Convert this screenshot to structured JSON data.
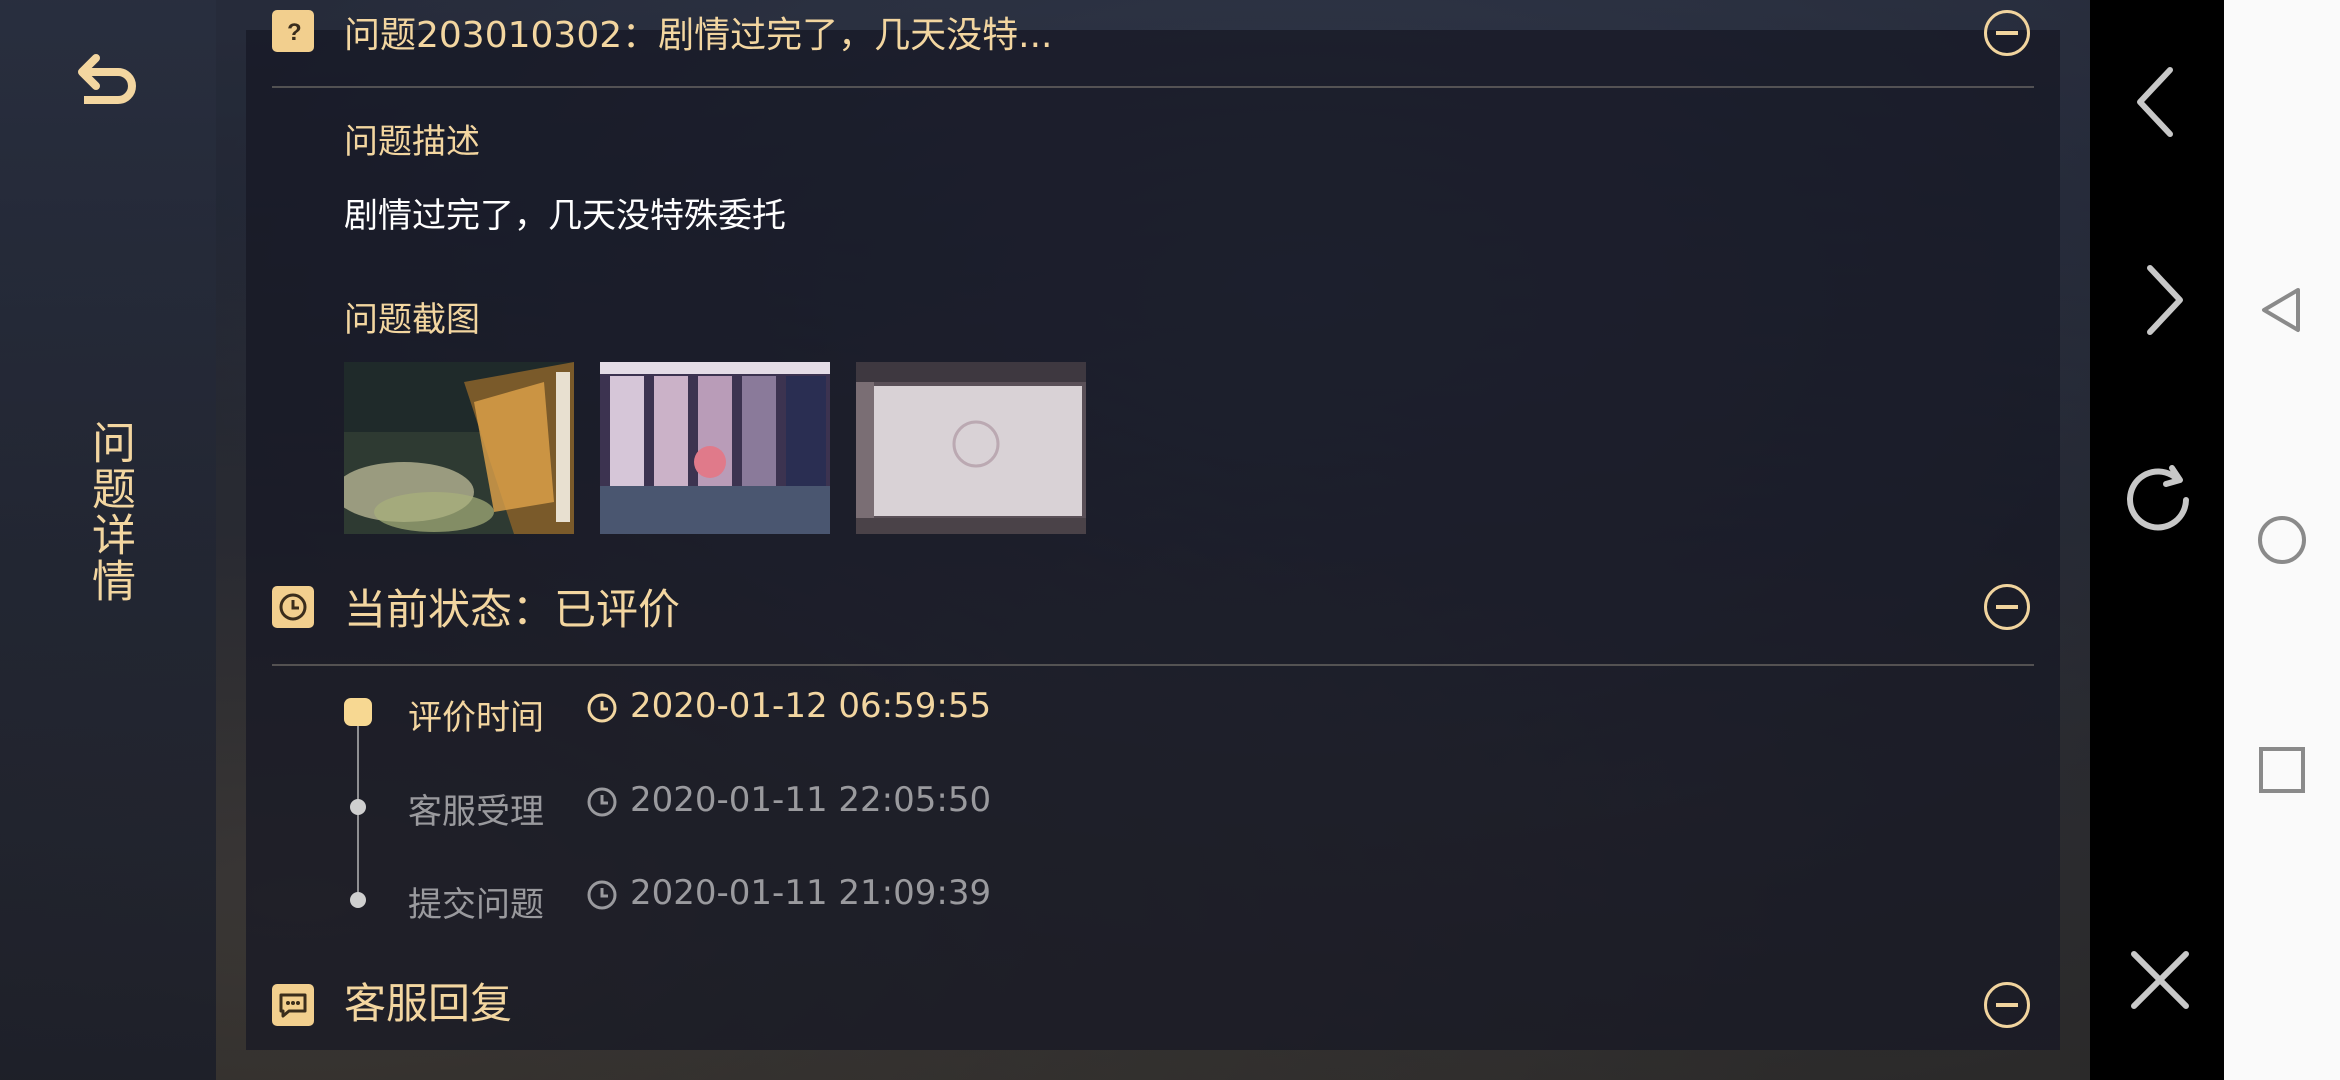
{
  "sidebar": {
    "title": "问题详情"
  },
  "question": {
    "title": "问题203010302：剧情过完了，几天没特...",
    "description_label": "问题描述",
    "description_text": "剧情过完了，几天没特殊委托",
    "screenshot_label": "问题截图"
  },
  "status": {
    "title": "当前状态：已评价",
    "timeline": [
      {
        "label": "评价时间",
        "time": "2020-01-12 06:59:55"
      },
      {
        "label": "客服受理",
        "time": "2020-01-11 22:05:50"
      },
      {
        "label": "提交问题",
        "time": "2020-01-11 21:09:39"
      }
    ]
  },
  "reply": {
    "title": "客服回复"
  },
  "colors": {
    "accent_gold": "#f3d6a0",
    "panel_bg": "#161824",
    "muted_text": "#9a9a9e"
  },
  "icons": {
    "back": "back-arrow-icon",
    "question": "question-mark-icon",
    "status": "clock-icon",
    "reply": "chat-bubble-icon",
    "collapse": "minus-circle-icon",
    "nav": [
      "chevron-left-icon",
      "chevron-right-icon",
      "refresh-icon",
      "close-icon"
    ],
    "system": [
      "triangle-back-icon",
      "circle-home-icon",
      "square-recents-icon"
    ]
  }
}
